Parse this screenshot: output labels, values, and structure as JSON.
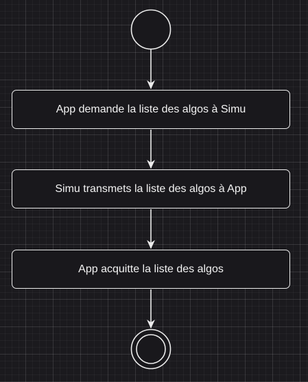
{
  "diagram": {
    "type": "activity-diagram",
    "start_node": "initial",
    "end_node": "final",
    "steps": [
      {
        "label": "App demande la liste des algos à Simu"
      },
      {
        "label": "Simu transmets la liste des algos à App"
      },
      {
        "label": "App acquitte la liste des algos"
      }
    ],
    "colors": {
      "background": "#1b1a1e",
      "stroke": "#ececec",
      "text": "#f2f2f2"
    }
  }
}
